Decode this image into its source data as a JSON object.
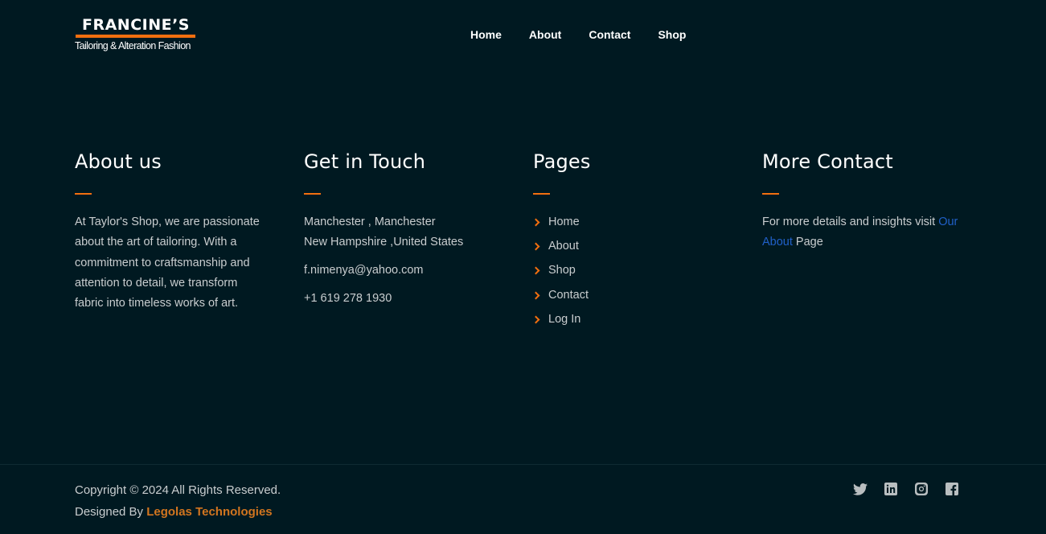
{
  "header": {
    "logo_name": "FRANCINE’S",
    "logo_tagline": "Tailoring & Alteration Fashion",
    "nav": [
      "Home",
      "About",
      "Contact",
      "Shop"
    ]
  },
  "about": {
    "title": "About us",
    "text": "At Taylor's Shop, we are passionate about the art of tailoring. With a commitment to craftsmanship and attention to detail, we transform fabric into timeless works of art."
  },
  "touch": {
    "title": "Get in Touch",
    "address_line1": "Manchester , Manchester",
    "address_line2": "New Hampshire ,United States",
    "email": "f.nimenya@yahoo.com",
    "phone": "+1 619 278 1930"
  },
  "pages": {
    "title": "Pages",
    "items": [
      "Home",
      "About",
      "Shop",
      "Contact",
      "Log In"
    ]
  },
  "more": {
    "title": "More Contact",
    "text_before": "For more details and insights visit ",
    "link": "Our About",
    "text_after": " Page"
  },
  "footer": {
    "copyright": "Copyright © 2024 All Rights Reserved.",
    "designed_by": "Designed By ",
    "designer": "Legolas Technologies"
  },
  "colors": {
    "background": "#001921",
    "accent": "#f26f0f",
    "link": "#2060c8",
    "designer": "#d2751f"
  },
  "social_icons": [
    "twitter-icon",
    "linkedin-icon",
    "instagram-icon",
    "facebook-icon"
  ]
}
